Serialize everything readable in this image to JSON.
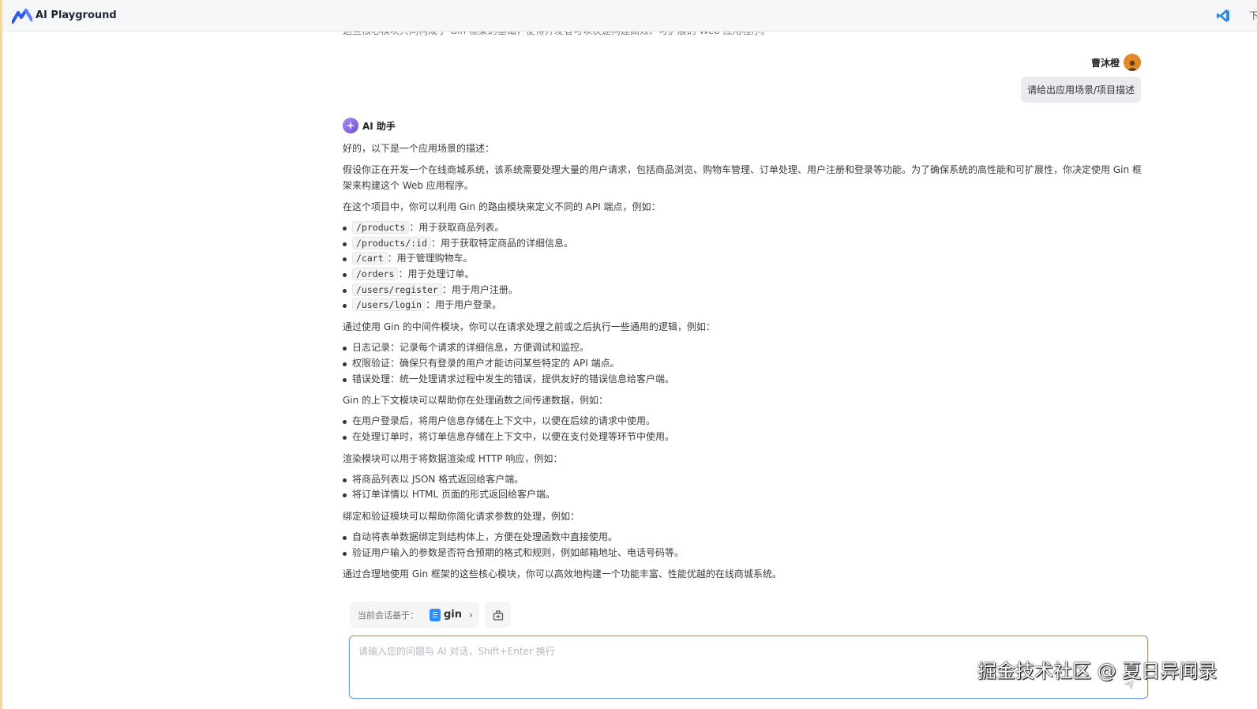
{
  "app": {
    "title": "AI Playground",
    "topbar_extra": "下"
  },
  "scroll_top_text": "这些核心模块共同构成了 Gin 框架的基础，使得开发者可以快速构建高效、可扩展的 Web 应用程序。",
  "user_message": {
    "name": "曹沐橙",
    "text": "请给出应用场景/项目描述"
  },
  "assistant": {
    "name": "AI 助手",
    "intro": "好的，以下是一个应用场景的描述：",
    "scenario": "假设你正在开发一个在线商城系统，该系统需要处理大量的用户请求，包括商品浏览、购物车管理、订单处理、用户注册和登录等功能。为了确保系统的高性能和可扩展性，你决定使用 Gin 框架来构建这个 Web 应用程序。",
    "routing_intro": "在这个项目中，你可以利用 Gin 的路由模块来定义不同的 API 端点，例如：",
    "routes": [
      {
        "path": "/products",
        "desc": "：用于获取商品列表。"
      },
      {
        "path": "/products/:id",
        "desc": "：用于获取特定商品的详细信息。"
      },
      {
        "path": "/cart",
        "desc": "：用于管理购物车。"
      },
      {
        "path": "/orders",
        "desc": "：用于处理订单。"
      },
      {
        "path": "/users/register",
        "desc": "：用于用户注册。"
      },
      {
        "path": "/users/login",
        "desc": "：用于用户登录。"
      }
    ],
    "middleware_intro": "通过使用 Gin 的中间件模块，你可以在请求处理之前或之后执行一些通用的逻辑，例如：",
    "middleware": [
      "日志记录：记录每个请求的详细信息，方便调试和监控。",
      "权限验证：确保只有登录的用户才能访问某些特定的 API 端点。",
      "错误处理：统一处理请求过程中发生的错误，提供友好的错误信息给客户端。"
    ],
    "context_intro": "Gin 的上下文模块可以帮助你在处理函数之间传递数据，例如：",
    "context": [
      "在用户登录后，将用户信息存储在上下文中，以便在后续的请求中使用。",
      "在处理订单时，将订单信息存储在上下文中，以便在支付处理等环节中使用。"
    ],
    "render_intro": "渲染模块可以用于将数据渲染成 HTTP 响应，例如：",
    "render": [
      "将商品列表以 JSON 格式返回给客户端。",
      "将订单详情以 HTML 页面的形式返回给客户端。"
    ],
    "binding_intro": "绑定和验证模块可以帮助你简化请求参数的处理，例如：",
    "binding": [
      "自动将表单数据绑定到结构体上，方便在处理函数中直接使用。",
      "验证用户输入的参数是否符合预期的格式和规则，例如邮箱地址、电话号码等。"
    ],
    "conclusion": "通过合理地使用 Gin 框架的这些核心模块，你可以高效地构建一个功能丰富、性能优越的在线商城系统。"
  },
  "context_bar": {
    "label": "当前会话基于：",
    "repo": "gin"
  },
  "input": {
    "placeholder": "请输入您的问题与 AI 对话，Shift+Enter 换行",
    "value": ""
  },
  "watermark": "掘金技术社区 @ 夏日异闻录",
  "icons": {
    "logo": "ai-playground-logo",
    "vscode": "vscode-icon",
    "clear": "clear-context-icon",
    "send": "send-icon",
    "doc": "doc-icon"
  },
  "colors": {
    "accent": "#2f8cff",
    "input_border": "#6fa0e8",
    "user_bubble": "#e9ebf0"
  }
}
